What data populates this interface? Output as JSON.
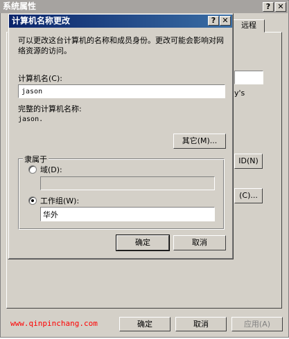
{
  "outer_window": {
    "title": "系统属性",
    "help_glyph": "?",
    "close_glyph": "✕",
    "tab_remote": "远程",
    "bg_text": "y's",
    "bg_netid_button": "ID(N)",
    "bg_change_button": "(C)...",
    "watermark": "www.qinpinchang.com",
    "ok": "确定",
    "cancel": "取消",
    "apply": "应用(A)"
  },
  "dialog": {
    "title": "计算机名称更改",
    "help_glyph": "?",
    "close_glyph": "✕",
    "description": "可以更改这台计算机的名称和成员身份。更改可能会影响对网络资源的访问。",
    "computer_name_label": "计算机名(C):",
    "computer_name_value": "jason",
    "full_name_label": "完整的计算机名称:",
    "full_name_value": "jason.",
    "more_button": "其它(M)...",
    "member_of_label": "隶属于",
    "domain_label": "域(D):",
    "domain_value": "",
    "workgroup_label": "工作组(W):",
    "workgroup_value": "华外",
    "selected": "workgroup",
    "ok": "确定",
    "cancel": "取消"
  }
}
